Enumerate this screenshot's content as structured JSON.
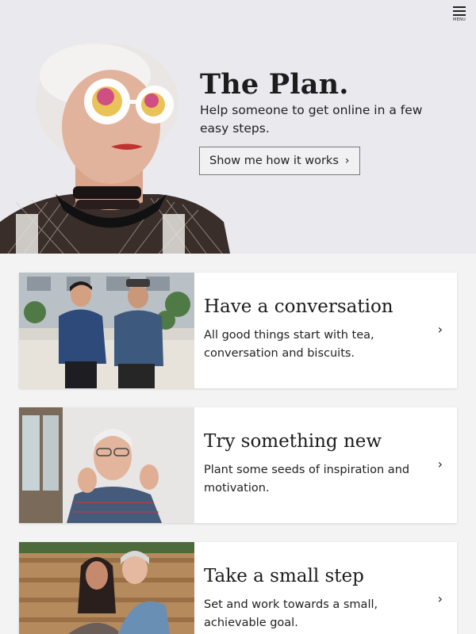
{
  "header": {
    "menu_label": "MENU"
  },
  "hero": {
    "title": "The Plan.",
    "subtitle": "Help someone to get online in a few easy steps.",
    "button_label": "Show me how it works",
    "button_chevron": "›"
  },
  "cards": [
    {
      "title": "Have a conversation",
      "text": "All good things start with tea, conversation and biscuits.",
      "arrow": "›"
    },
    {
      "title": "Try something new",
      "text": "Plant some seeds of inspiration and motivation.",
      "arrow": "›"
    },
    {
      "title": "Take a small step",
      "text": "Set and work towards a small, achievable goal.",
      "arrow": "›"
    }
  ],
  "colors": {
    "hero_bg": "#e9e9ee",
    "page_bg": "#f3f3f4",
    "card_bg": "#ffffff",
    "text": "#222222"
  }
}
